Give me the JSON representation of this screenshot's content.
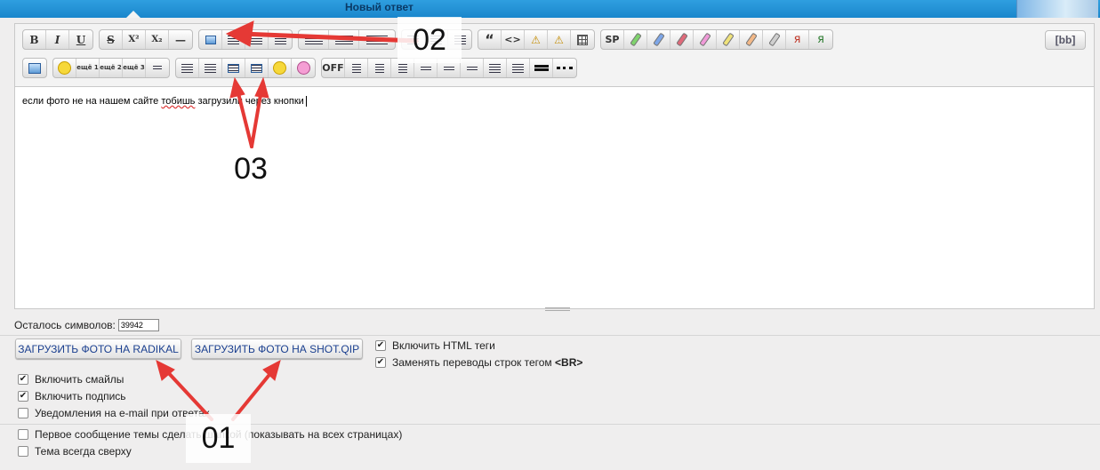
{
  "header": {
    "title": "Новый ответ"
  },
  "toolbar": {
    "row1": {
      "format": [
        "B",
        "I",
        "U"
      ],
      "script": [
        "S",
        "X²",
        "X₂",
        "—"
      ],
      "quote_code": [
        "“",
        "<>"
      ],
      "sp": "SP",
      "bb": "[bb]"
    },
    "row2": {
      "more1": "ещё 1",
      "more2": "ещё 2",
      "more3": "ещё 3",
      "off": "OFF"
    }
  },
  "editor": {
    "text_before": "если фото не на нашем сайте ",
    "text_error": "тобишь",
    "text_after": " загрузили через кнопки"
  },
  "remaining": {
    "label": "Осталось символов:",
    "value": "39942"
  },
  "upload_buttons": {
    "radikal": "ЗАГРУЗИТЬ ФОТО НА RADIKAL",
    "shot": "ЗАГРУЗИТЬ ФОТО НА SHOT.QIP"
  },
  "options": {
    "enable_html": "Включить HTML теги",
    "replace_br": "Заменять переводы строк тегом",
    "replace_br_tag": "<BR>",
    "enable_smileys": "Включить смайлы",
    "enable_signature": "Включить подпись",
    "email_notify": "Уведомления на e-mail при ответах",
    "first_post_sticky": "Первое сообщение темы сделать шапкой (показывать на всех страницах)",
    "topic_always_top": "Тема всегда сверху"
  },
  "checked": {
    "enable_html": true,
    "replace_br": true,
    "enable_smileys": true,
    "enable_signature": true,
    "email_notify": false,
    "first_post_sticky": false,
    "topic_always_top": false
  },
  "annotations": {
    "n01": "01",
    "n02": "02",
    "n03": "03"
  },
  "colors": {
    "annotation_arrow": "#e53935",
    "header_blue": "#1a86cc",
    "link_blue": "#1a3f8f"
  }
}
